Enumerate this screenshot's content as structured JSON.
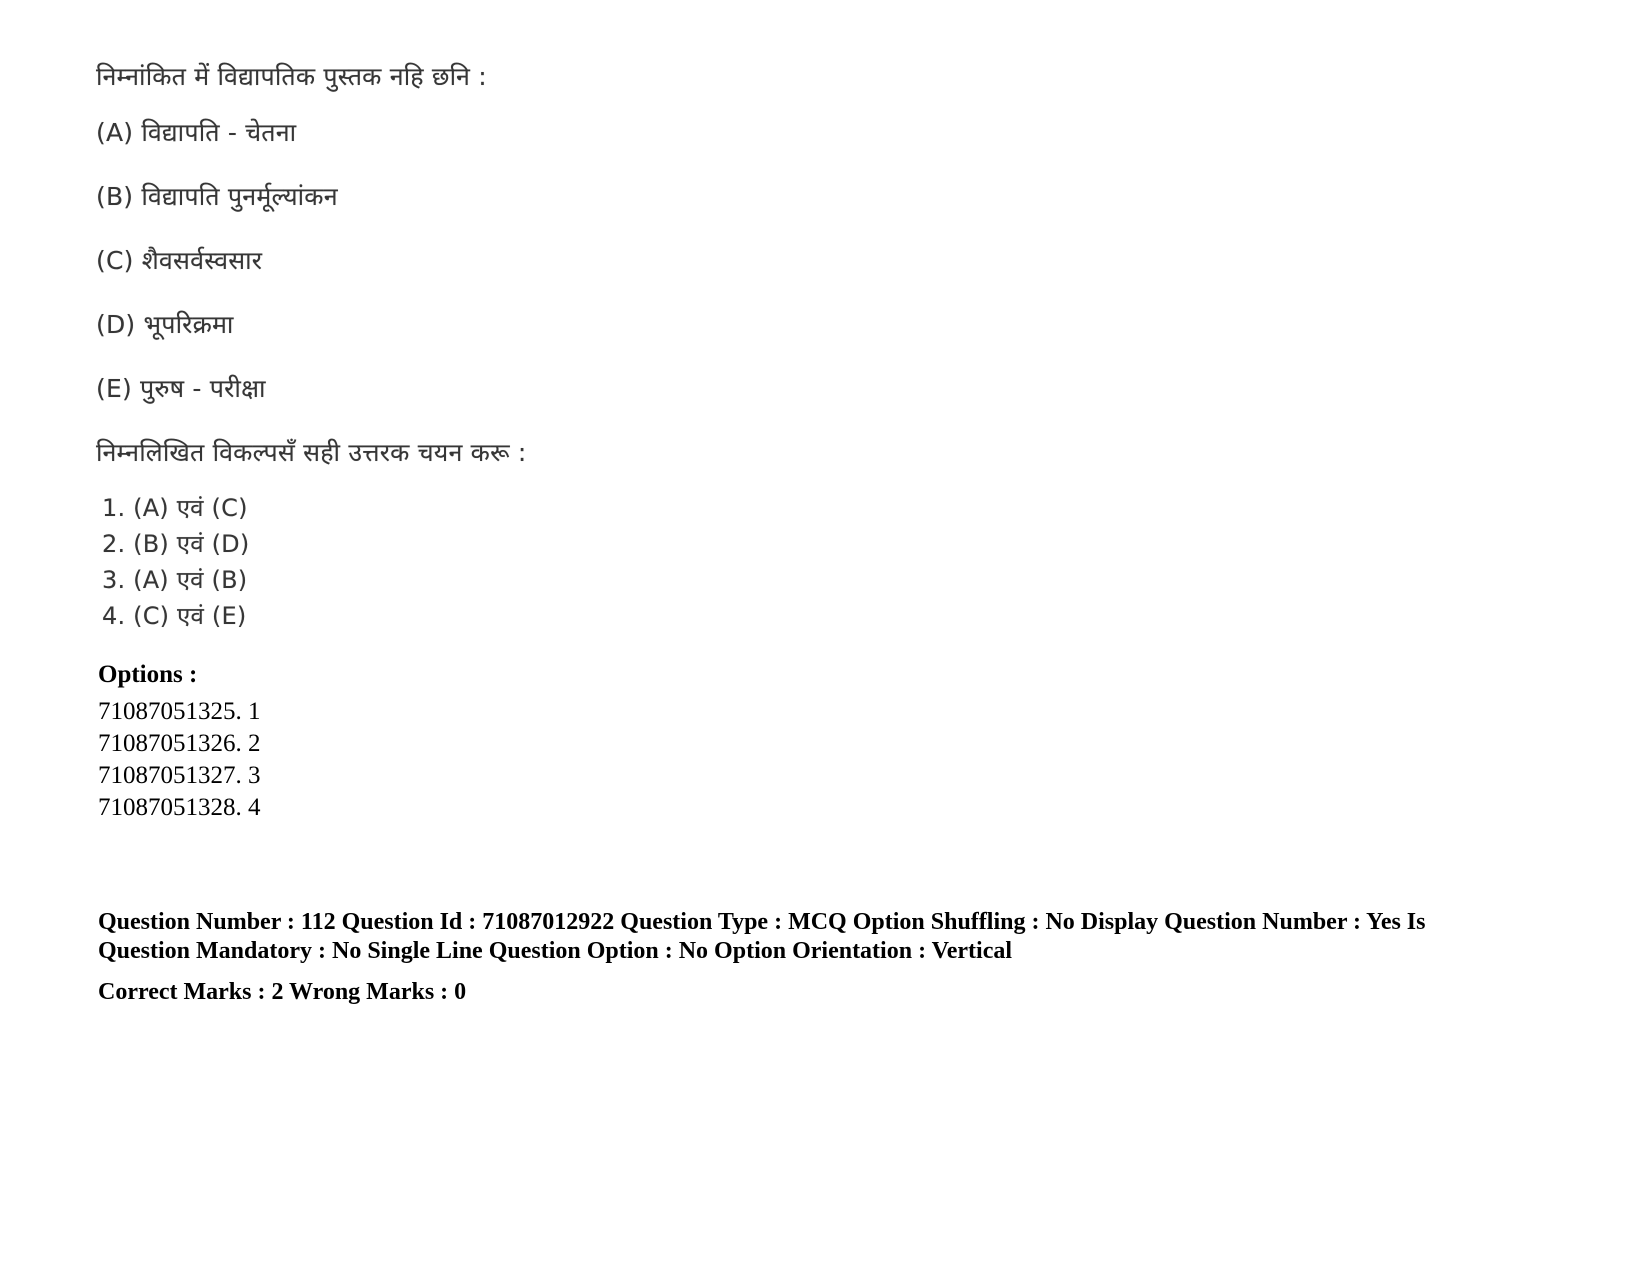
{
  "document": {
    "type": "exam-question-page",
    "background_color": "#ffffff",
    "text_color": "#000000"
  },
  "question": {
    "stem": "निम्नांकित में विद्यापतिक पुस्तक नहि छनि :",
    "choices": [
      {
        "label": "(A)",
        "text": "(A) विद्यापति - चेतना"
      },
      {
        "label": "(B)",
        "text": "(B) विद्यापति पुनर्मूल्यांकन"
      },
      {
        "label": "(C)",
        "text": "(C) शैवसर्वस्वसार"
      },
      {
        "label": "(D)",
        "text": "(D) भूपरिक्रमा"
      },
      {
        "label": "(E)",
        "text": "(E) पुरुष - परीक्षा"
      }
    ],
    "sub_instruction": "निम्नलिखित विकल्पसँ सही उत्तरक चयन करू :",
    "combinations": [
      "1. (A) एवं (C)",
      "2. (B) एवं (D)",
      "3. (A) एवं (B)",
      "4. (C) एवं (E)"
    ]
  },
  "options": {
    "heading": "Options :",
    "items": [
      {
        "id": "71087051325.",
        "value": "1",
        "line": "71087051325. 1"
      },
      {
        "id": "71087051326.",
        "value": "2",
        "line": "71087051326. 2"
      },
      {
        "id": "71087051327.",
        "value": "3",
        "line": "71087051327. 3"
      },
      {
        "id": "71087051328.",
        "value": "4",
        "line": "71087051328. 4"
      }
    ]
  },
  "metadata": {
    "question_number": "112",
    "question_id": "71087012922",
    "question_type": "MCQ",
    "option_shuffling": "No",
    "display_question_number": "Yes",
    "is_question_mandatory": "No",
    "single_line_question_option": "No",
    "option_orientation": "Vertical",
    "correct_marks": "2",
    "wrong_marks": "0",
    "line1": "Question Number : 112 Question Id : 71087012922 Question Type : MCQ Option Shuffling : No Display Question Number : Yes Is",
    "line2": "Question Mandatory : No Single Line Question Option : No Option Orientation : Vertical",
    "line3": "Correct Marks : 2 Wrong Marks : 0"
  }
}
